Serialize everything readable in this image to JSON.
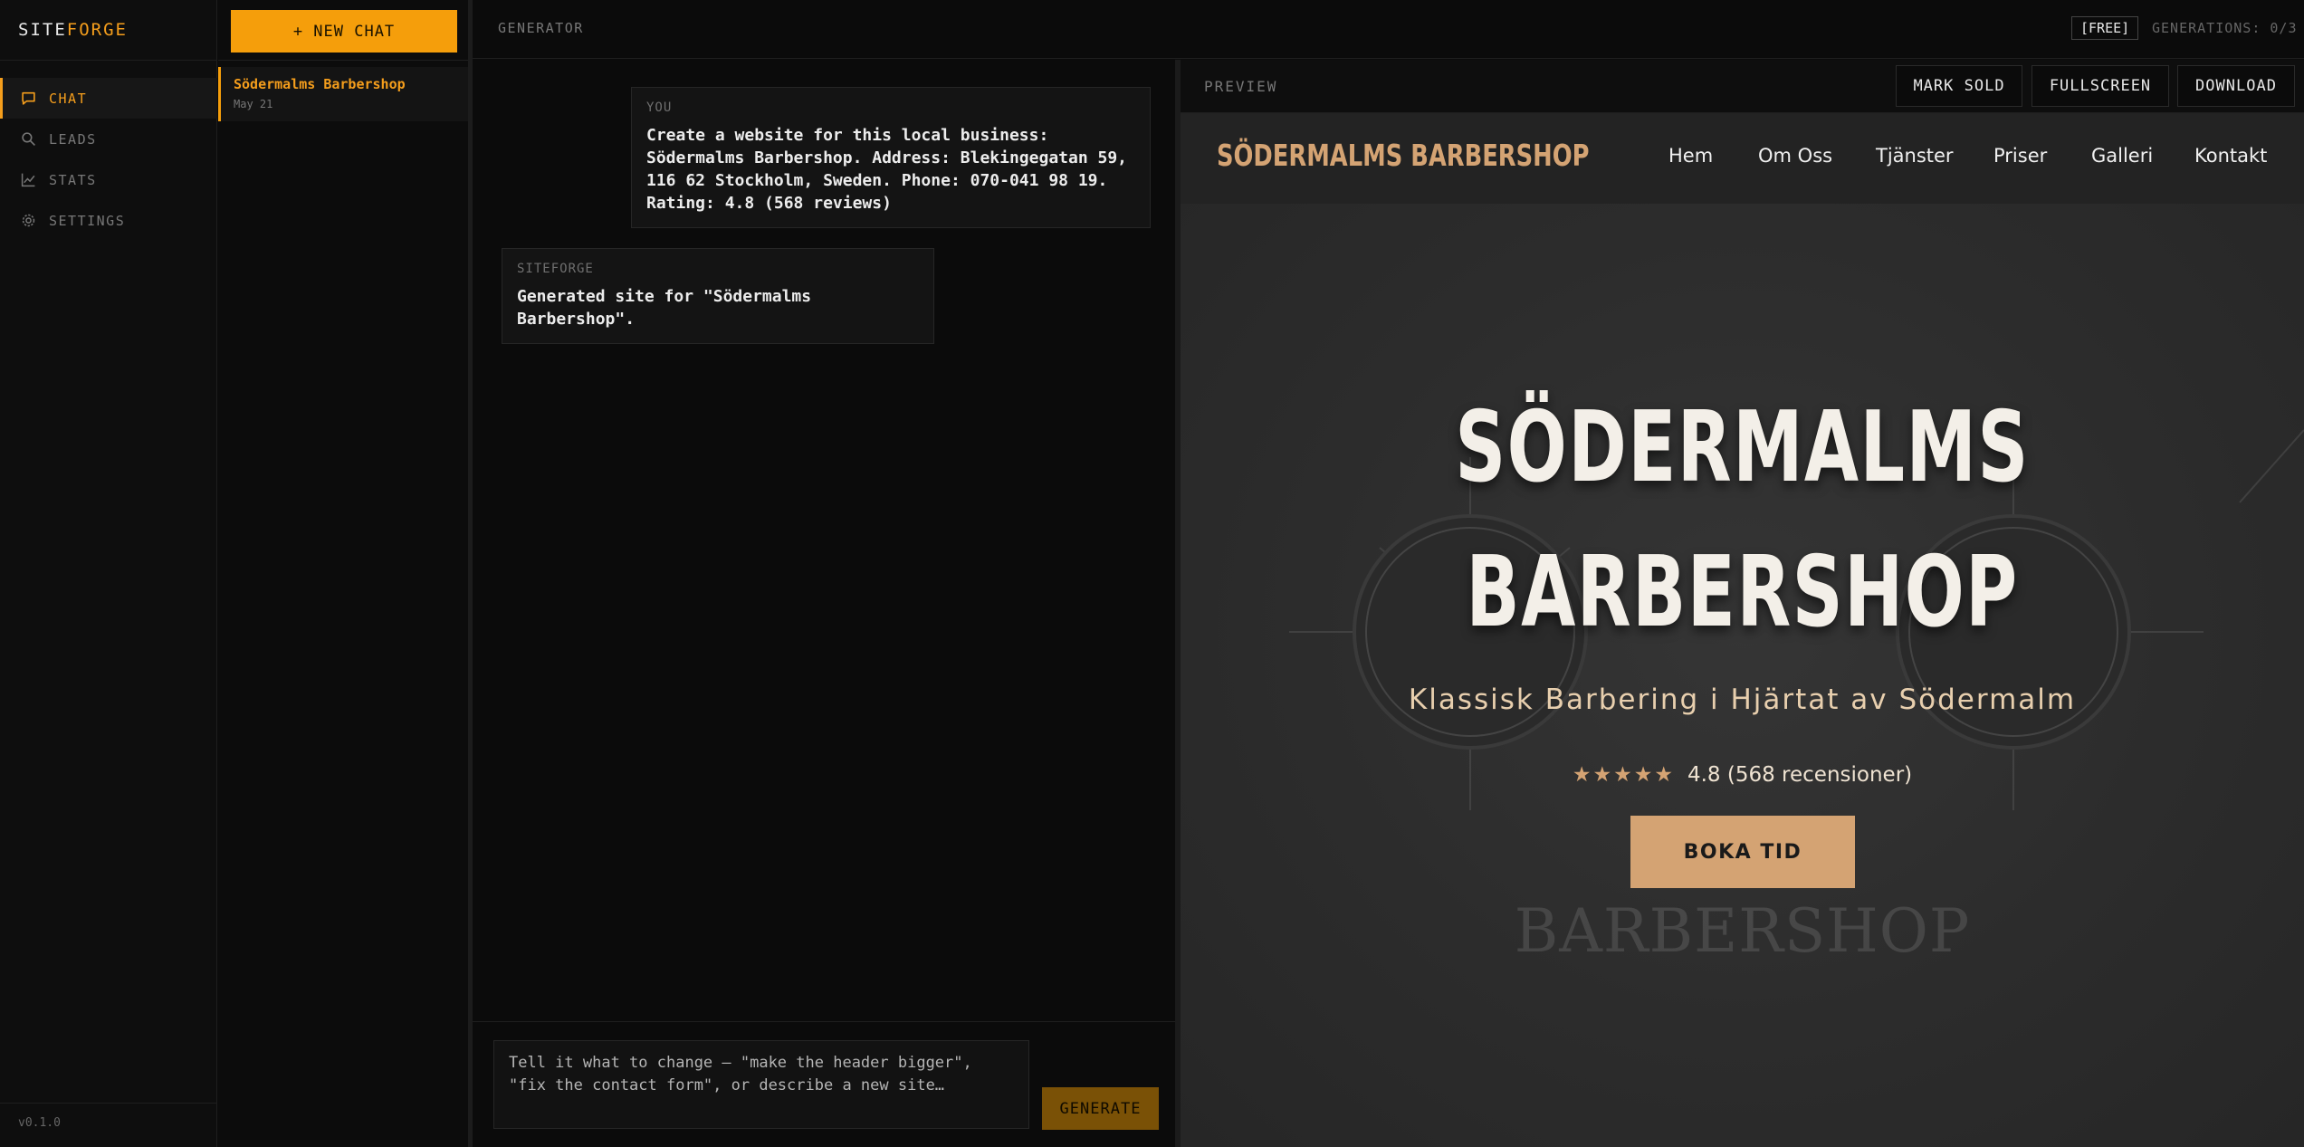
{
  "brand": {
    "prefix": "SITE",
    "accent": "FORGE"
  },
  "nav": {
    "items": [
      {
        "label": "CHAT",
        "icon": "chat-bubble-icon",
        "active": true
      },
      {
        "label": "LEADS",
        "icon": "search-icon",
        "active": false
      },
      {
        "label": "STATS",
        "icon": "line-chart-icon",
        "active": false
      },
      {
        "label": "SETTINGS",
        "icon": "gear-icon",
        "active": false
      }
    ],
    "version": "v0.1.0"
  },
  "chatlist": {
    "new_chat_label": "+ NEW CHAT",
    "items": [
      {
        "title": "Södermalms Barbershop",
        "date": "May 21"
      }
    ]
  },
  "topbar": {
    "title": "GENERATOR",
    "plan": "[FREE]",
    "generations": "GENERATIONS: 0/3"
  },
  "messages": {
    "user": {
      "who": "YOU",
      "text": "Create a website for this local business: Södermalms Barbershop. Address: Blekingegatan 59, 116 62 Stockholm, Sweden. Phone: 070-041 98 19. Rating: 4.8 (568 reviews)"
    },
    "bot": {
      "who": "SITEFORGE",
      "text": "Generated site for \"Södermalms Barbershop\"."
    }
  },
  "composer": {
    "placeholder": "Tell it what to change — \"make the header bigger\", \"fix the contact form\", or describe a new site…",
    "generate_label": "GENERATE"
  },
  "preview": {
    "label": "PREVIEW",
    "mark_sold": "MARK SOLD",
    "fullscreen": "FULLSCREEN",
    "download": "DOWNLOAD"
  },
  "site": {
    "logo": "SÖDERMALMS BARBERSHOP",
    "links": [
      "Hem",
      "Om Oss",
      "Tjänster",
      "Priser",
      "Galleri",
      "Kontakt"
    ],
    "hero_line1": "SÖDERMALMS",
    "hero_line2": "BARBERSHOP",
    "subtitle": "Klassisk Barbering i Hjärtat av Södermalm",
    "stars": "★★★★★",
    "rating_text": "4.8 (568 recensioner)",
    "cta": "BOKA TID",
    "watermark": "BARBERSHOP"
  },
  "colors": {
    "accent": "#f59e0b",
    "site_gold": "#d4a373",
    "background": "#0b0b0b"
  }
}
